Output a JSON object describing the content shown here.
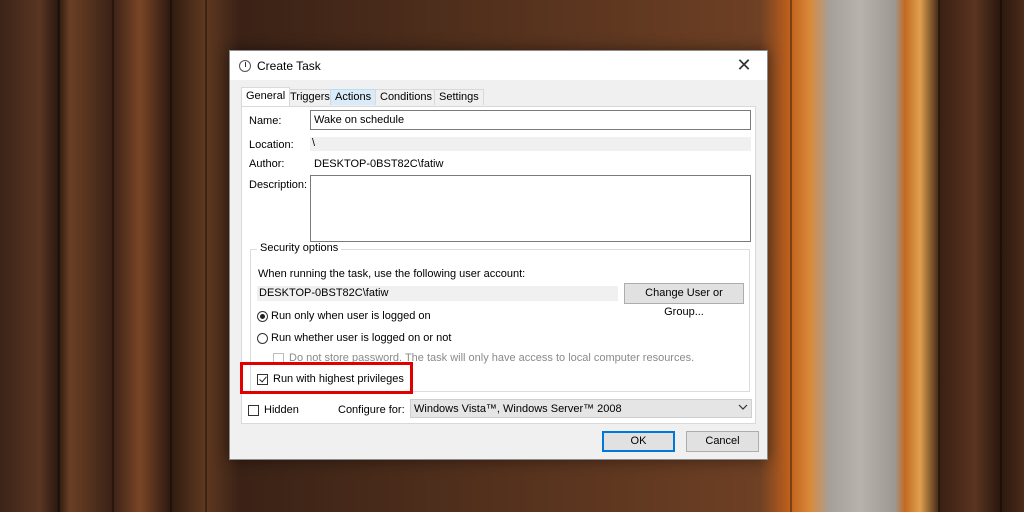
{
  "window": {
    "title": "Create Task",
    "close_glyph": "✕"
  },
  "tabs": [
    {
      "label": "General"
    },
    {
      "label": "Triggers"
    },
    {
      "label": "Actions"
    },
    {
      "label": "Conditions"
    },
    {
      "label": "Settings"
    }
  ],
  "general": {
    "name_label": "Name:",
    "name_value": "Wake on schedule",
    "location_label": "Location:",
    "location_value": "\\",
    "author_label": "Author:",
    "author_value": "DESKTOP-0BST82C\\fatiw",
    "description_label": "Description:",
    "description_value": ""
  },
  "security": {
    "group_title": "Security options",
    "account_prompt": "When running the task, use the following user account:",
    "account_value": "DESKTOP-0BST82C\\fatiw",
    "change_user_button": "Change User or Group...",
    "radio_logged_on": "Run only when user is logged on",
    "radio_whether": "Run whether user is logged on or not",
    "no_store_password": "Do not store password.  The task will only have access to local computer resources.",
    "highest_privileges": "Run with highest privileges",
    "selected_radio": "radio_logged_on",
    "highest_privileges_checked": true
  },
  "footer": {
    "hidden_label": "Hidden",
    "hidden_checked": false,
    "configure_label": "Configure for:",
    "configure_value": "Windows Vista™, Windows Server™ 2008",
    "ok_button": "OK",
    "cancel_button": "Cancel"
  },
  "colors": {
    "highlight": "#e00000",
    "accent": "#0078d7"
  }
}
